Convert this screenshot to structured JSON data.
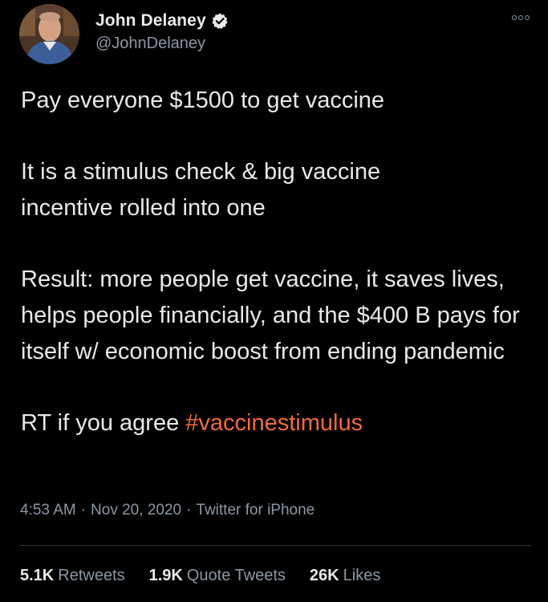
{
  "author": {
    "display_name": "John Delaney",
    "handle": "@JohnDelaney",
    "verified": true,
    "avatar_icon": "profile-photo"
  },
  "tweet": {
    "paragraphs": [
      "Pay everyone $1500 to get vaccine",
      "It is a stimulus check & big vaccine incentive rolled into one",
      "Result: more people get vaccine, it saves lives, helps people financially, and the $400 B pays for itself w/ economic boost from ending pandemic"
    ],
    "last_line_prefix": "RT if you agree ",
    "hashtag": "#vaccinestimulus",
    "hashtag_color": "#f26a3d"
  },
  "meta": {
    "time": "4:53 AM",
    "separator": "·",
    "date": "Nov 20, 2020",
    "source": "Twitter for iPhone"
  },
  "stats": {
    "retweets_count": "5.1K",
    "retweets_label": "Retweets",
    "quote_count": "1.9K",
    "quote_label": "Quote Tweets",
    "likes_count": "26K",
    "likes_label": "Likes"
  },
  "colors": {
    "background": "#000000",
    "text_primary": "#e7e9ea",
    "text_secondary": "#8b98a5",
    "divider": "#2f3336"
  },
  "icons": {
    "more": "more-options-icon",
    "verified": "verified-badge-icon"
  }
}
